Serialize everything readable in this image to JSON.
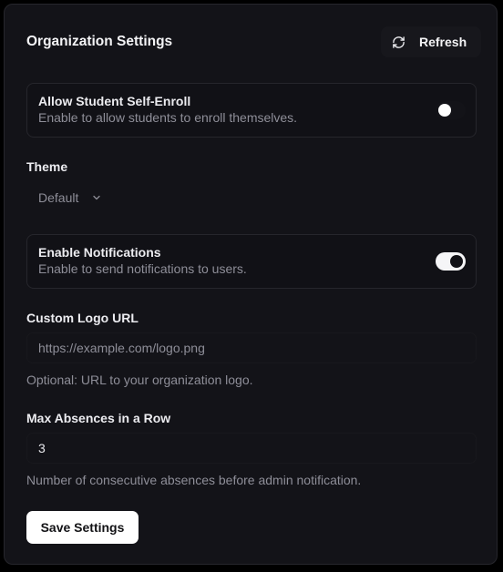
{
  "page": {
    "title": "Organization Settings"
  },
  "refresh_button": {
    "label": "Refresh",
    "icon": "refresh-icon"
  },
  "self_enroll": {
    "title": "Allow Student Self-Enroll",
    "description": "Enable to allow students to enroll themselves.",
    "enabled": false
  },
  "theme": {
    "label": "Theme",
    "selected": "Default",
    "icon": "chevron-down-icon"
  },
  "notifications": {
    "title": "Enable Notifications",
    "description": "Enable to send notifications to users.",
    "enabled": true
  },
  "logo_url": {
    "label": "Custom Logo URL",
    "value": "",
    "placeholder": "https://example.com/logo.png",
    "help": "Optional: URL to your organization logo."
  },
  "max_absences": {
    "label": "Max Absences in a Row",
    "value": "3",
    "help": "Number of consecutive absences before admin notification."
  },
  "save_button": {
    "label": "Save Settings"
  },
  "colors": {
    "background": "#000000",
    "card": "#131318",
    "border": "#26262c",
    "text_primary": "#ececf0",
    "text_muted": "#8e8e98",
    "button_primary_bg": "#ffffff"
  }
}
